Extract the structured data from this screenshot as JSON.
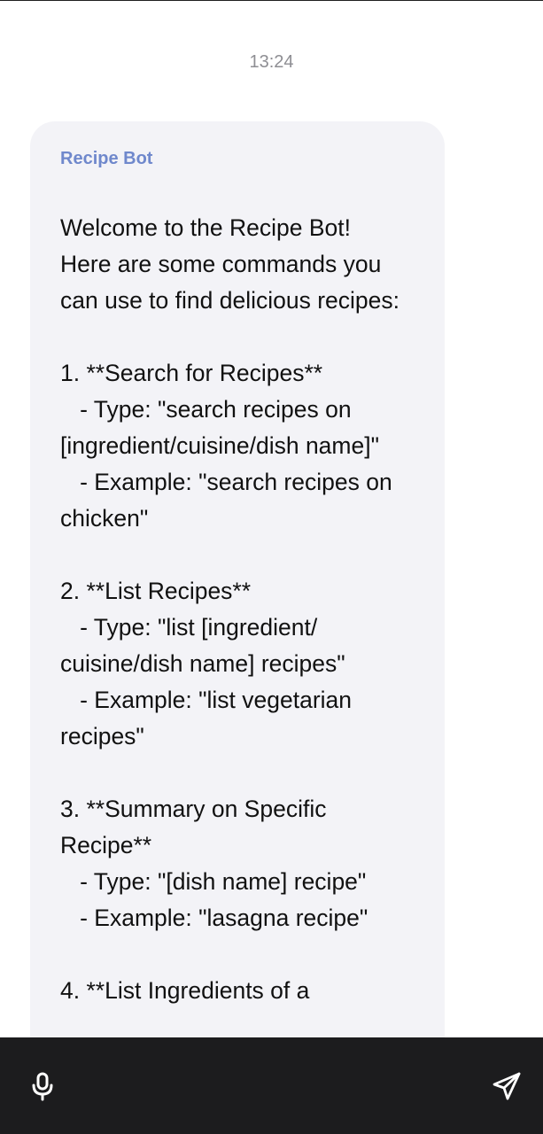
{
  "status": {
    "timestamp": "13:24"
  },
  "chat": {
    "messages": [
      {
        "sender": "Recipe Bot",
        "text": "Welcome to the Recipe Bot!\nHere are some commands you can use to find delicious recipes:\n\n1. **Search for Recipes**\n   - Type: \"search recipes on [ingredient/cuisine/dish name]\"\n   - Example: \"search recipes on chicken\"\n\n2. **List Recipes**\n   - Type: \"list [ingredient/ cuisine/dish name] recipes\"\n   - Example: \"list vegetarian recipes\"\n\n3. **Summary on Specific Recipe**\n   - Type: \"[dish name] recipe\"\n   - Example: \"lasagna recipe\"\n\n4. **List Ingredients of a"
      }
    ]
  },
  "composer": {
    "mic_icon": "microphone-icon",
    "send_icon": "send-icon"
  },
  "colors": {
    "sender_name": "#6f88cc",
    "bubble_background": "#f3f3f7",
    "bottom_bar": "#1c1c1e"
  }
}
